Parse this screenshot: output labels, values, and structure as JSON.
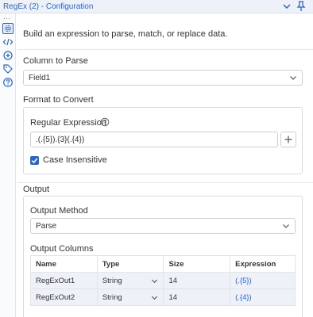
{
  "window": {
    "title": "RegEx (2) - Configuration",
    "accent": "#2b66c2"
  },
  "iconbar": {
    "items": [
      "gear-icon",
      "code-icon",
      "add-circle-icon",
      "tag-icon",
      "help-icon"
    ],
    "active": "gear-icon"
  },
  "description": "Build an expression to parse, match, or replace data.",
  "column_to_parse": {
    "label": "Column to Parse",
    "value": "Field1"
  },
  "format": {
    "section_label": "Format to Convert",
    "regex_label": "Regular Expression",
    "regex_value": ".(.{5}).{3}(.{4})",
    "case_insensitive_label": "Case Insensitive",
    "case_insensitive_checked": true
  },
  "output": {
    "section_label": "Output",
    "method_label": "Output Method",
    "method_value": "Parse",
    "columns_label": "Output Columns",
    "headers": [
      "Name",
      "Type",
      "Size",
      "Expression"
    ],
    "rows": [
      {
        "name": "RegExOut1",
        "type": "String",
        "size": "14",
        "expression": "(.{5})"
      },
      {
        "name": "RegExOut2",
        "type": "String",
        "size": "14",
        "expression": "(.{4})"
      }
    ]
  }
}
